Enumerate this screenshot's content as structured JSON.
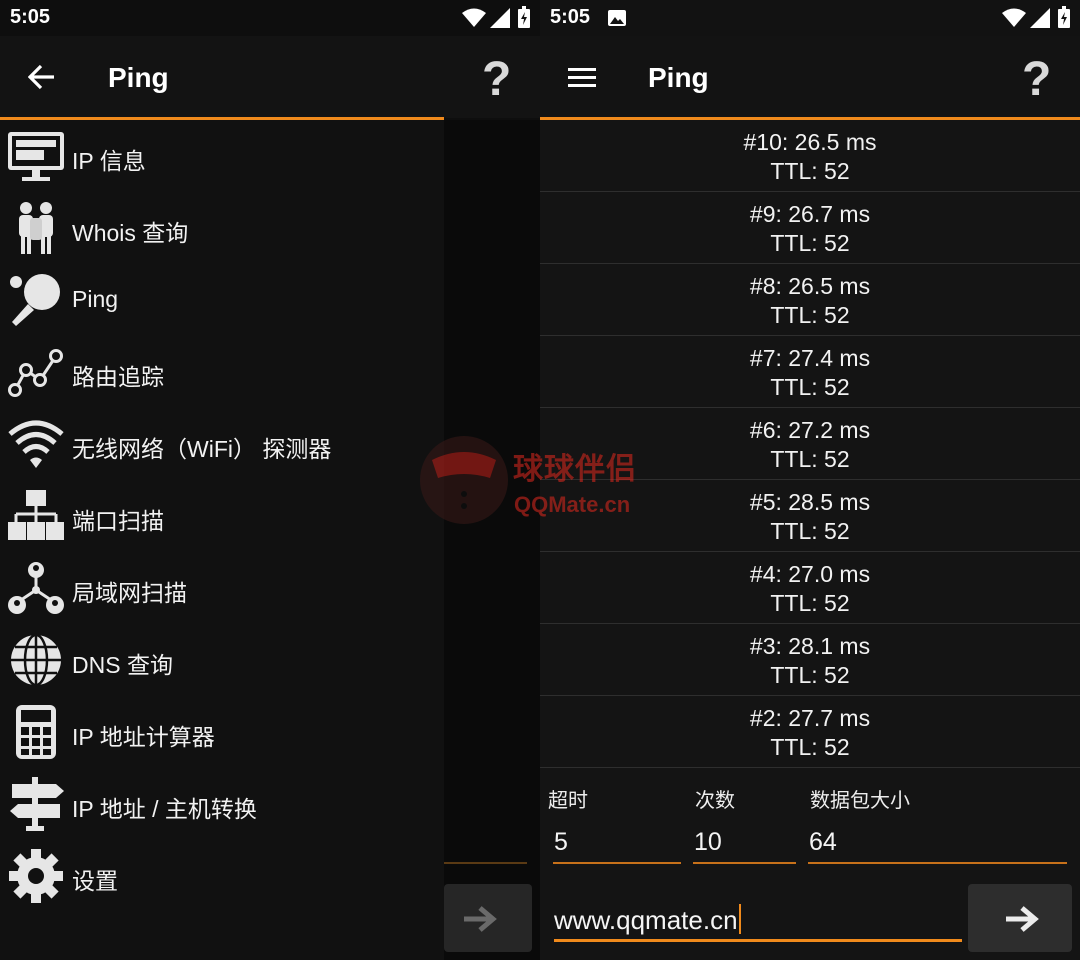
{
  "left_screen": {
    "status": {
      "time": "5:05"
    },
    "appbar": {
      "title": "Ping",
      "help": "?"
    },
    "drawer": {
      "items": [
        {
          "label": "IP 信息",
          "icon": "monitor-icon"
        },
        {
          "label": "Whois 查询",
          "icon": "people-icon"
        },
        {
          "label": "Ping",
          "icon": "ping-pong-icon"
        },
        {
          "label": "路由追踪",
          "icon": "route-icon"
        },
        {
          "label": "无线网络（WiFi） 探测器",
          "icon": "wifi-icon"
        },
        {
          "label": "端口扫描",
          "icon": "network-ports-icon"
        },
        {
          "label": "局域网扫描",
          "icon": "lan-users-icon"
        },
        {
          "label": "DNS 查询",
          "icon": "globe-icon"
        },
        {
          "label": "IP 地址计算器",
          "icon": "calculator-icon"
        },
        {
          "label": "IP 地址 / 主机转换",
          "icon": "signpost-icon"
        },
        {
          "label": "设置",
          "icon": "gear-icon"
        }
      ]
    }
  },
  "right_screen": {
    "status": {
      "time": "5:05"
    },
    "appbar": {
      "title": "Ping",
      "help": "?"
    },
    "results": [
      {
        "line1": "#10: 26.5 ms",
        "line2": "TTL: 52"
      },
      {
        "line1": "#9: 26.7 ms",
        "line2": "TTL: 52"
      },
      {
        "line1": "#8: 26.5 ms",
        "line2": "TTL: 52"
      },
      {
        "line1": "#7: 27.4 ms",
        "line2": "TTL: 52"
      },
      {
        "line1": "#6: 27.2 ms",
        "line2": "TTL: 52"
      },
      {
        "line1": "#5: 28.5 ms",
        "line2": "TTL: 52"
      },
      {
        "line1": "#4: 27.0 ms",
        "line2": "TTL: 52"
      },
      {
        "line1": "#3: 28.1 ms",
        "line2": "TTL: 52"
      },
      {
        "line1": "#2: 27.7 ms",
        "line2": "TTL: 52"
      }
    ],
    "fields": {
      "timeout": {
        "label": "超时",
        "value": "5"
      },
      "count": {
        "label": "次数",
        "value": "10"
      },
      "packet_size": {
        "label": "数据包大小",
        "value": "64"
      }
    },
    "host": {
      "value": "www.qqmate.cn"
    }
  },
  "watermark": {
    "title": "球球伴侣",
    "domain": "QQMate.cn"
  },
  "colors": {
    "accent": "#f08a1c",
    "background": "#121212",
    "watermark": "#e0281e"
  }
}
